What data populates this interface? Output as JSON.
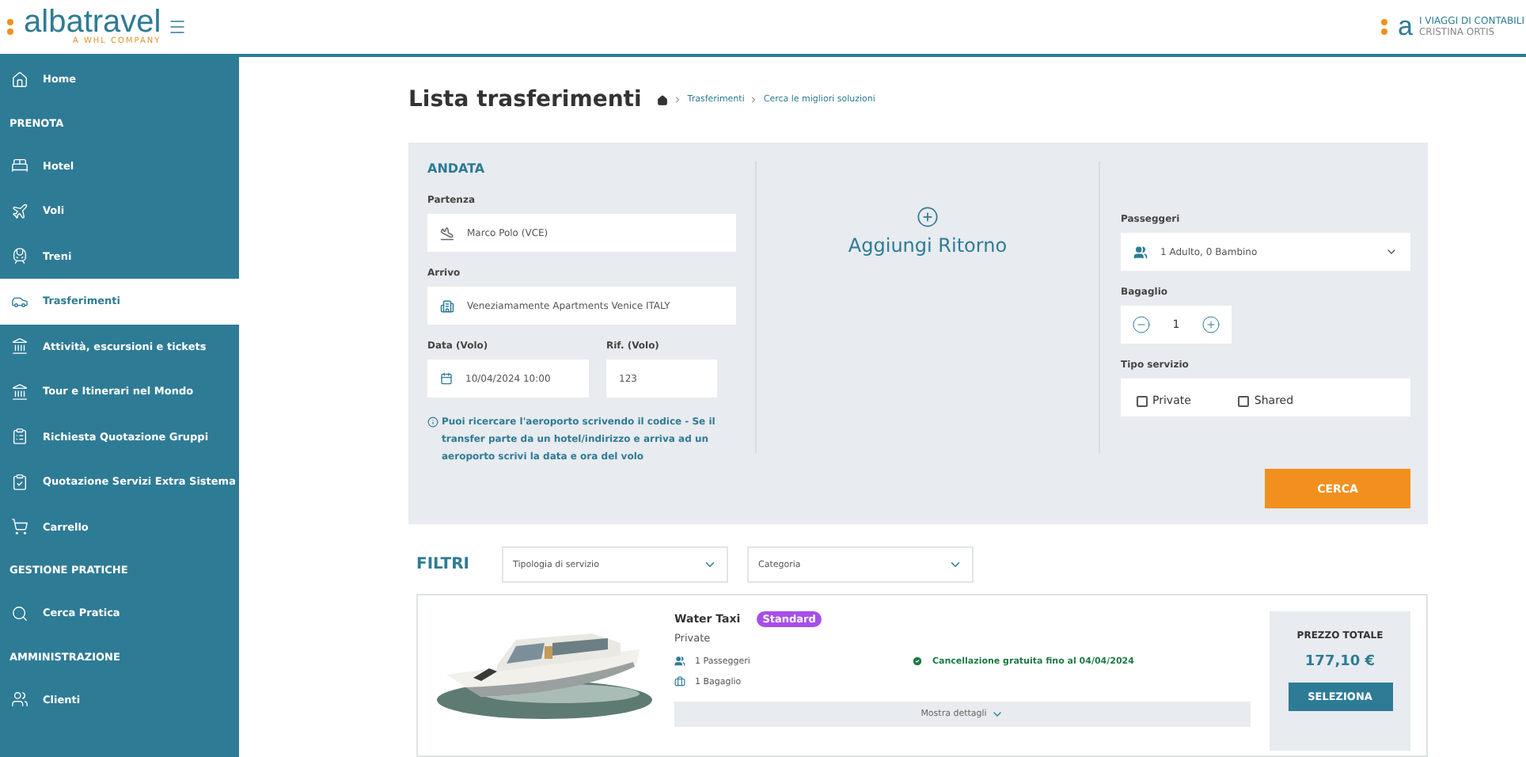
{
  "header": {
    "brand": "albatravel",
    "tagline": "A WHL COMPANY",
    "agency_logo": "a",
    "agency": "I VIAGGI DI CONTABILI",
    "user": "CRISTINA ORTIS"
  },
  "sidebar": {
    "items": [
      {
        "kind": "item",
        "label": "Home",
        "selected": false
      },
      {
        "kind": "section",
        "label": "PRENOTA"
      },
      {
        "kind": "item",
        "label": "Hotel",
        "selected": false
      },
      {
        "kind": "item",
        "label": "Voli",
        "selected": false
      },
      {
        "kind": "item",
        "label": "Treni",
        "selected": false
      },
      {
        "kind": "item",
        "label": "Trasferimenti",
        "selected": true
      },
      {
        "kind": "item",
        "label": "Attività, escursioni e tickets",
        "selected": false
      },
      {
        "kind": "item",
        "label": "Tour e Itinerari nel Mondo",
        "selected": false
      },
      {
        "kind": "item",
        "label": "Richiesta Quotazione Gruppi",
        "selected": false
      },
      {
        "kind": "item",
        "label": "Quotazione Servizi Extra Sistema",
        "selected": false
      },
      {
        "kind": "item",
        "label": "Carrello",
        "selected": false
      },
      {
        "kind": "section",
        "label": "GESTIONE PRATICHE"
      },
      {
        "kind": "item",
        "label": "Cerca Pratica",
        "selected": false
      },
      {
        "kind": "section",
        "label": "AMMINISTRAZIONE"
      },
      {
        "kind": "item",
        "label": "Clienti",
        "selected": false
      }
    ]
  },
  "page": {
    "title": "Lista trasferimenti",
    "breadcrumb": [
      "Trasferimenti",
      "Cerca le migliori soluzioni"
    ]
  },
  "search": {
    "heading": "ANDATA",
    "departure": {
      "label": "Partenza",
      "value": "Marco Polo (VCE)"
    },
    "arrival": {
      "label": "Arrivo",
      "value": "Veneziamamente Apartments Venice ITALY"
    },
    "date": {
      "label": "Data (Volo)",
      "value": "10/04/2024 10:00"
    },
    "flight_ref": {
      "label": "Rif. (Volo)",
      "value": "123"
    },
    "hint": "Puoi ricercare l'aeroporto scrivendo il codice - Se il transfer parte da un hotel/indirizzo e arriva ad un aeroporto scrivi la data e ora del volo",
    "add_return": "Aggiungi Ritorno",
    "passengers": {
      "label": "Passeggeri",
      "value": "1 Adulto, 0 Bambino"
    },
    "luggage": {
      "label": "Bagaglio",
      "value": "1"
    },
    "service_type": {
      "label": "Tipo servizio",
      "options": [
        {
          "label": "Private",
          "checked": false
        },
        {
          "label": "Shared",
          "checked": false
        }
      ]
    },
    "submit": "CERCA"
  },
  "filters": {
    "title": "FILTRI",
    "selects": [
      {
        "placeholder": "Tipologia di servizio"
      },
      {
        "placeholder": "Categoria"
      }
    ]
  },
  "results": [
    {
      "name": "Water Taxi",
      "badge": "Standard",
      "type": "Private",
      "passengers": "1 Passeggeri",
      "luggage": "1 Bagaglio",
      "cancellation": "Cancellazione gratuita fino al 04/04/2024",
      "details": "Mostra dettagli",
      "price_label": "PREZZO TOTALE",
      "price": "177,10 €",
      "select": "SELEZIONA"
    }
  ]
}
